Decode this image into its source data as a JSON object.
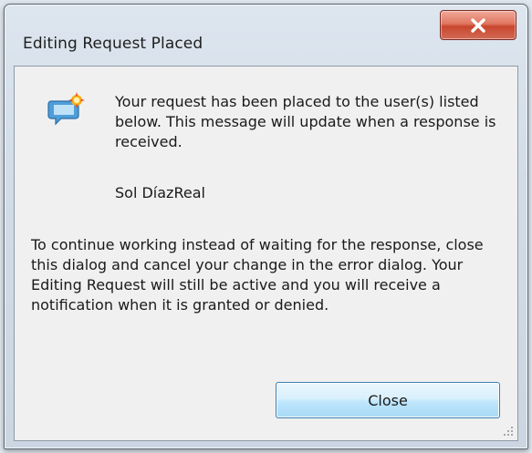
{
  "window": {
    "title": "Editing Request Placed",
    "close_icon": "close-x-icon"
  },
  "message": {
    "icon": "speech-bubble-notification-icon",
    "text": "Your request has been placed to the user(s) listed below. This message will update when a response is received.",
    "user": "Sol DíazReal"
  },
  "info": {
    "text": "To continue working instead of waiting for the response, close this dialog and cancel your change in the error dialog.  Your Editing Request will still be active and you will receive a notification when it is granted or denied."
  },
  "buttons": {
    "close_label": "Close"
  },
  "colors": {
    "close_button_red": "#c8472e",
    "button_blue": "#bee6fd",
    "dialog_face": "#f0f0f0"
  }
}
